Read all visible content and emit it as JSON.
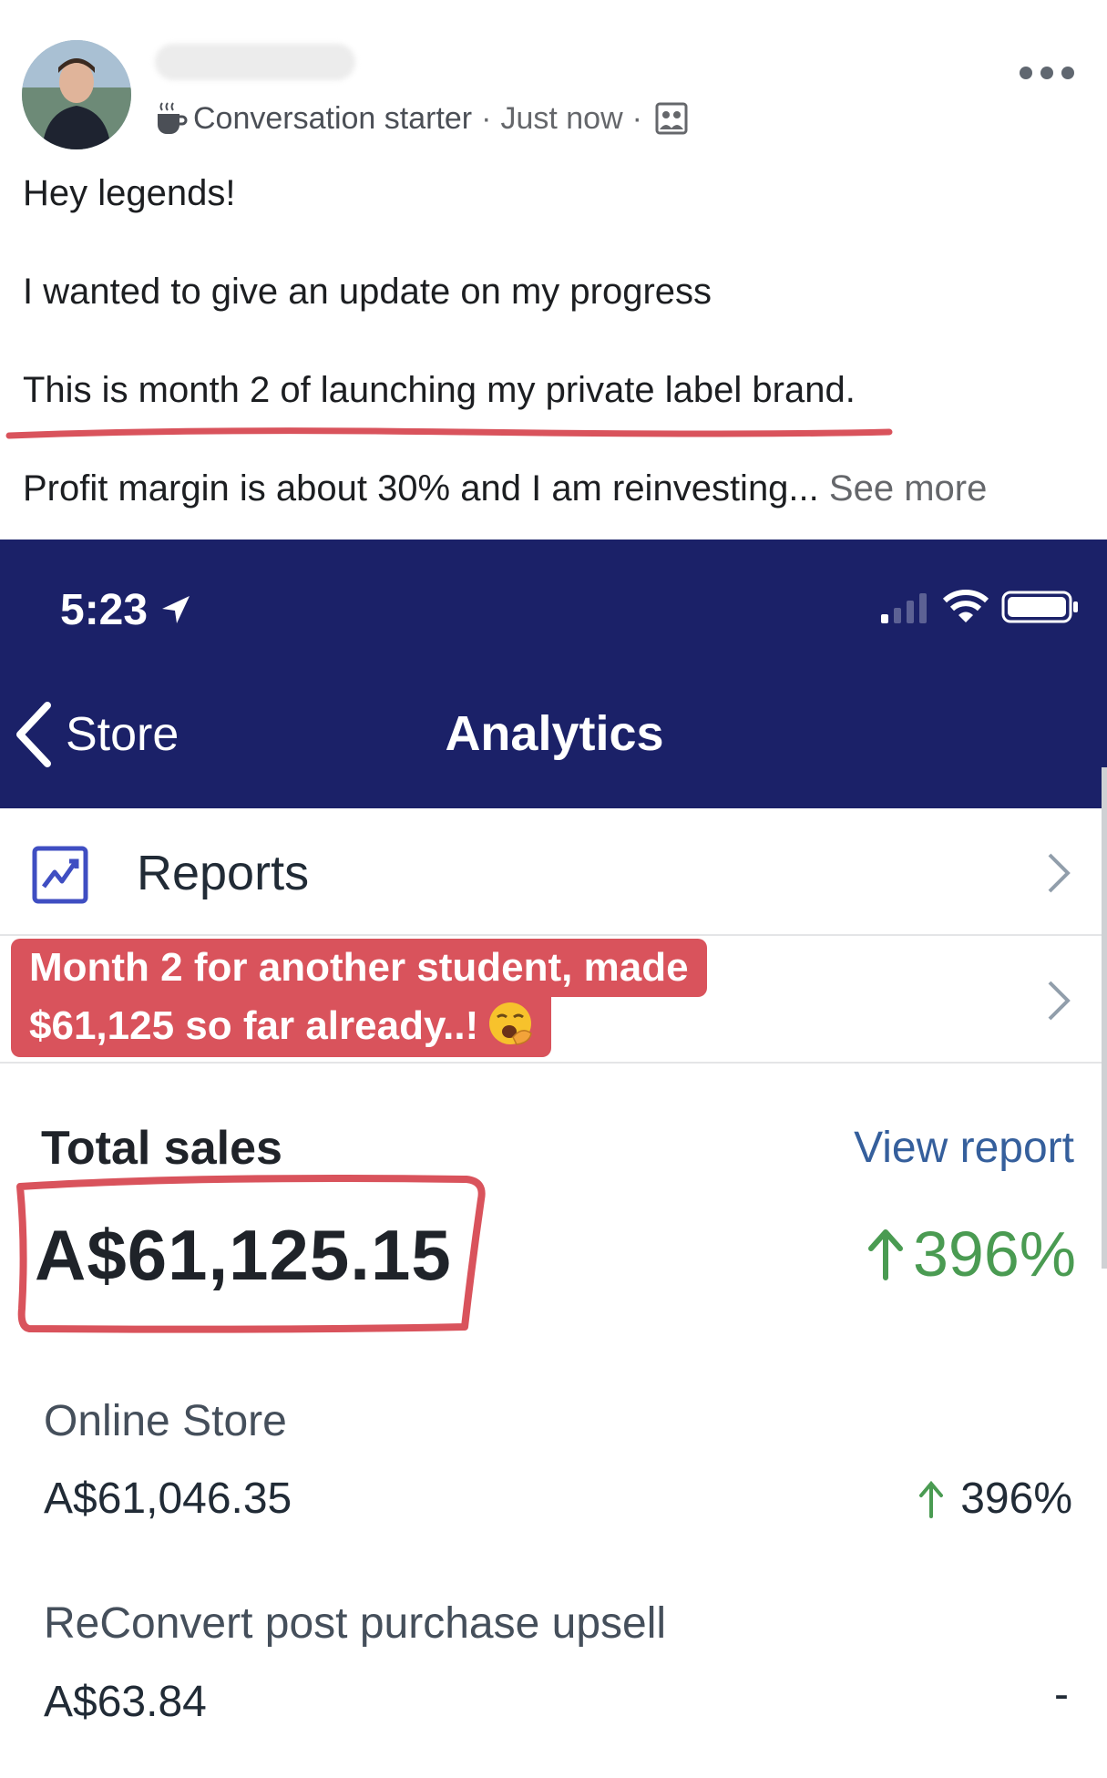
{
  "post": {
    "meta": {
      "badge_label": "Conversation starter",
      "separator": "·",
      "time": "Just now"
    },
    "lines": [
      "Hey legends!",
      "I wanted to give an update on my progress",
      "This is month 2 of launching my private label brand.",
      "Profit margin is about 30% and I am reinvesting..."
    ],
    "see_more": "See more",
    "annotation_color": "#d9535c"
  },
  "phone": {
    "status_time": "5:23",
    "nav": {
      "back_label": "Store",
      "title": "Analytics",
      "bar_color": "#1b2168"
    },
    "reports_label": "Reports",
    "overlay_note": {
      "line1": "Month 2 for another student, made",
      "line2": "$61,125 so far already..!"
    },
    "total_sales": {
      "label": "Total sales",
      "view_report": "View report",
      "value": "A$61,125.15",
      "change": "396%",
      "change_color": "#4a9b52"
    },
    "channels": [
      {
        "label": "Online Store",
        "value": "A$61,046.35",
        "change": "396%"
      },
      {
        "label": "ReConvert post purchase upsell",
        "value": "A$63.84",
        "change": "-"
      }
    ]
  }
}
